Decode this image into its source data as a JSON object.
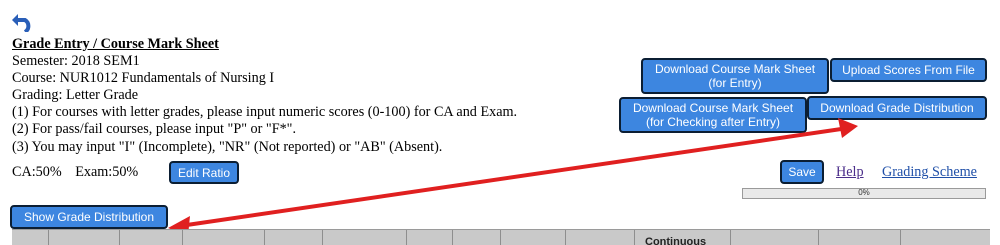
{
  "header": {
    "back_icon": "undo-arrow-icon",
    "title": "Grade Entry / Course Mark Sheet",
    "semester": "Semester: 2018 SEM1",
    "course": "Course: NUR1012 Fundamentals of Nursing I",
    "grading": "Grading: Letter Grade"
  },
  "instructions": [
    "(1) For courses with letter grades, please input numeric scores (0-100) for CA and Exam.",
    "(2) For pass/fail courses, please input \"P\" or \"F*\".",
    "(3) You may input \"I\" (Incomplete), \"NR\" (Not reported) or \"AB\" (Absent)."
  ],
  "ratio": {
    "ca": "CA:50%",
    "exam": "Exam:50%",
    "edit_label": "Edit Ratio"
  },
  "buttons": {
    "download_entry_line1": "Download Course Mark Sheet",
    "download_entry_line2": "(for Entry)",
    "upload_scores": "Upload Scores From File",
    "download_checking_line1": "Download Course Mark Sheet",
    "download_checking_line2": "(for Checking after Entry)",
    "download_distribution": "Download Grade Distribution",
    "save": "Save",
    "show_distribution": "Show Grade Distribution"
  },
  "links": {
    "help": "Help",
    "grading_scheme": "Grading Scheme"
  },
  "progress": {
    "value": 0,
    "label": "0%"
  },
  "table": {
    "visible_header": "Continuous"
  },
  "colors": {
    "button_bg": "#3d86e0",
    "button_border": "#0b1e33",
    "arrow": "#e02020"
  }
}
